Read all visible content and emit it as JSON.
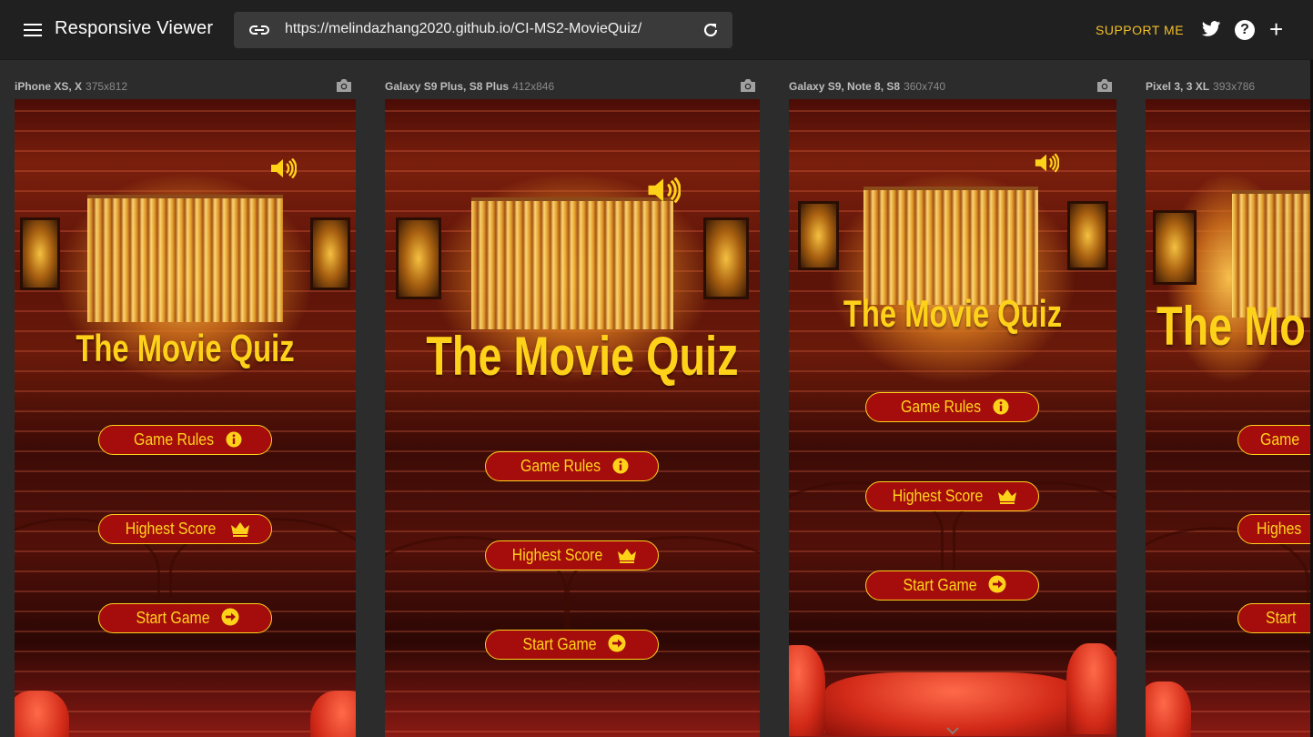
{
  "app": {
    "title": "Responsive Viewer",
    "url": "https://melindazhang2020.github.io/CI-MS2-MovieQuiz/",
    "support_label": "SUPPORT ME",
    "help_glyph": "?",
    "add_glyph": "+",
    "accent_color": "#f3bf2a",
    "icons": [
      "menu-icon",
      "link-icon",
      "reload-icon",
      "twitter-icon",
      "help-icon",
      "plus-icon",
      "camera-icon",
      "volume-icon",
      "info-icon",
      "crown-icon",
      "arrow-circle-right-icon",
      "chevron-down-icon"
    ]
  },
  "devices": [
    {
      "name": "iPhone XS, X",
      "size": "375x812"
    },
    {
      "name": "Galaxy S9 Plus, S8 Plus",
      "size": "412x846"
    },
    {
      "name": "Galaxy S9, Note 8, S8",
      "size": "360x740"
    },
    {
      "name": "Pixel 3, 3 XL",
      "size": "393x786"
    }
  ],
  "quiz": {
    "title": "The Movie Quiz",
    "title_color": "#ffd21a",
    "button_bg": "#a50d0d",
    "buttons": {
      "rules": "Game Rules",
      "score": "Highest Score",
      "start": "Start Game"
    },
    "clipped_labels": {
      "title": "The Mo",
      "rules": "Game",
      "score": "Highes",
      "start": "Start"
    }
  }
}
